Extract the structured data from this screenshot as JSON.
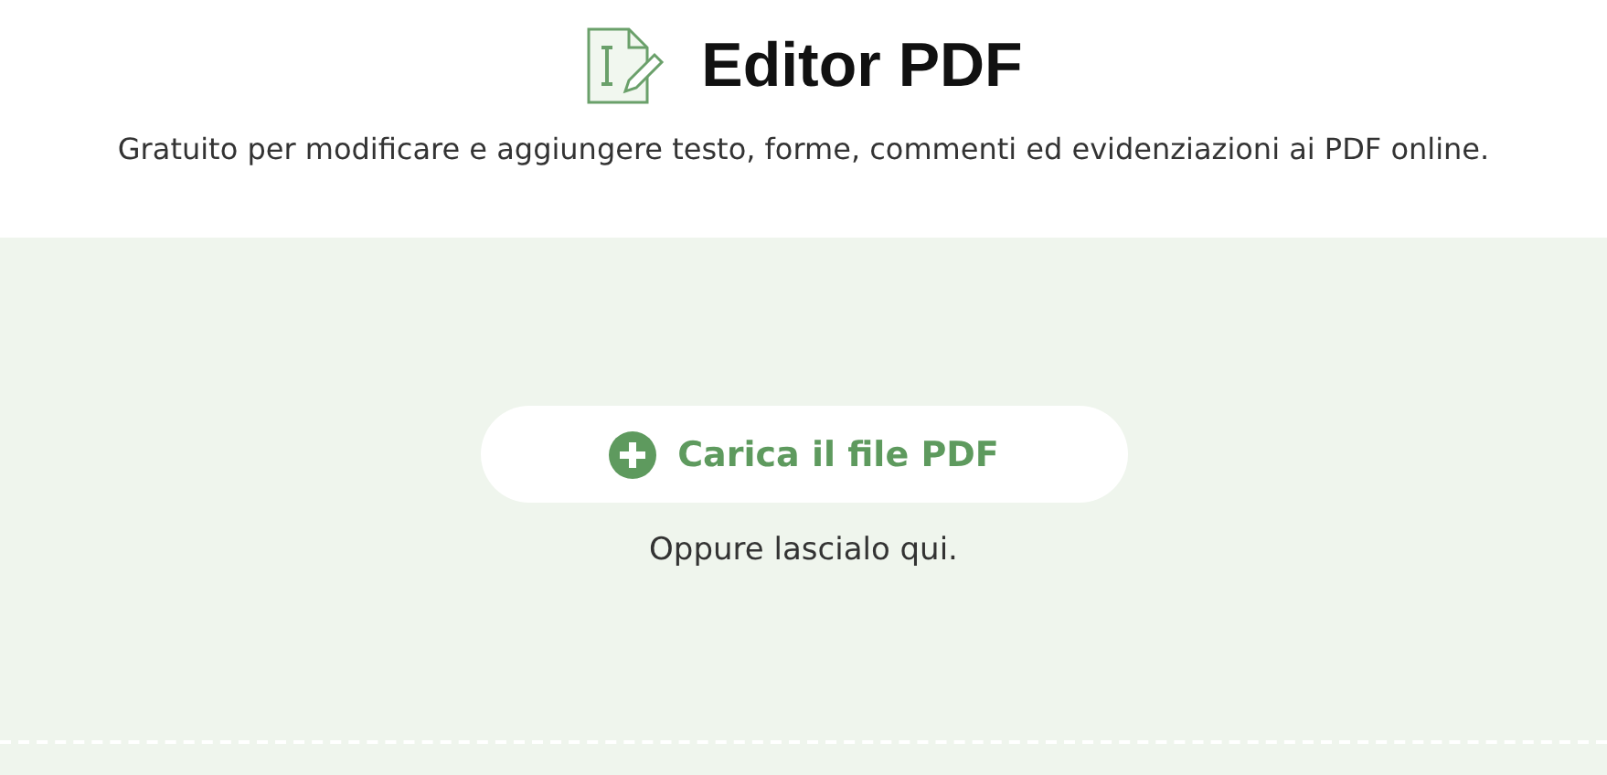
{
  "header": {
    "title": "Editor PDF",
    "subtitle": "Gratuito per modificare e aggiungere testo, forme, commenti ed evidenziazioni ai PDF online."
  },
  "dropzone": {
    "button": "Carica il file PDF",
    "hint": "Oppure lascialo qui."
  }
}
